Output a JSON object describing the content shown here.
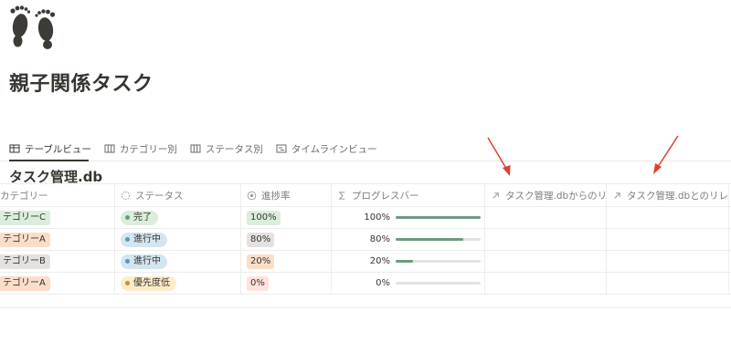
{
  "page": {
    "icon": "footprints-icon",
    "title": "親子関係タスク"
  },
  "tabs": [
    {
      "label": "テーブルビュー",
      "icon": "table-icon",
      "active": true
    },
    {
      "label": "カテゴリー別",
      "icon": "board-icon",
      "active": false
    },
    {
      "label": "ステータス別",
      "icon": "board-icon",
      "active": false
    },
    {
      "label": "タイムラインビュー",
      "icon": "timeline-icon",
      "active": false
    }
  ],
  "database": {
    "title": "タスク管理.db",
    "columns": [
      {
        "label": "カテゴリー",
        "icon": ""
      },
      {
        "label": "ステータス",
        "icon": "status-icon"
      },
      {
        "label": "進捗率",
        "icon": "formula-icon"
      },
      {
        "label": "プログレスバー",
        "icon": "sigma-icon"
      },
      {
        "label": "タスク管理.dbからのリ...",
        "icon": "relation-arrow-icon"
      },
      {
        "label": "タスク管理.dbとのリレ...",
        "icon": "relation-arrow-icon"
      }
    ],
    "rows": [
      {
        "category": "テゴリーC",
        "category_color": "#dbeddb",
        "status": "完了",
        "status_bg": "#dbeddb",
        "status_dot": "#6c9b7d",
        "pct": "100%",
        "pct_bg": "#dbeddb",
        "progress_label": "100%",
        "progress": 1.0
      },
      {
        "category": "テゴリーA",
        "category_color": "#fadec9",
        "status": "進行中",
        "status_bg": "#d3e5ef",
        "status_dot": "#5b97bd",
        "pct": "80%",
        "pct_bg": "#e3e2e0",
        "progress_label": "80%",
        "progress": 0.8
      },
      {
        "category": "テゴリーB",
        "category_color": "#e3e2e0",
        "status": "進行中",
        "status_bg": "#d3e5ef",
        "status_dot": "#5b97bd",
        "pct": "20%",
        "pct_bg": "#fadec9",
        "progress_label": "20%",
        "progress": 0.2
      },
      {
        "category": "テゴリーA",
        "category_color": "#fadec9",
        "status": "優先度低",
        "status_bg": "#fdecc8",
        "status_dot": "#cb912f",
        "pct": "0%",
        "pct_bg": "#ffe2dd",
        "progress_label": "0%",
        "progress": 0.0
      }
    ]
  },
  "colors": {
    "accent_arrow": "#e03e2d",
    "progress_fill": "#6c9b7d",
    "text": "#37352f"
  }
}
